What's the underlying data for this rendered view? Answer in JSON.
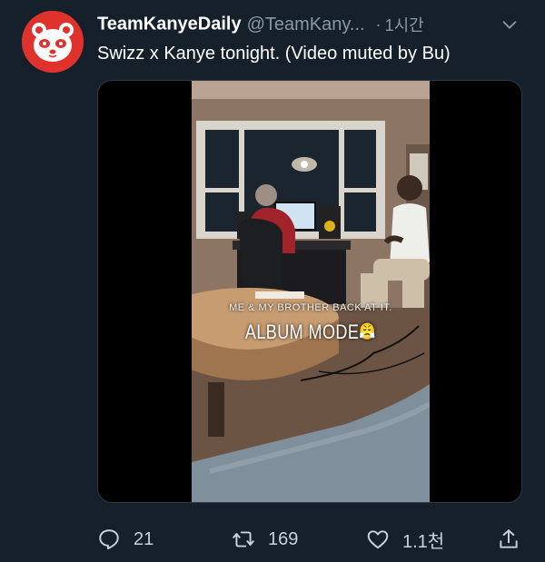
{
  "tweet": {
    "display_name": "TeamKanyeDaily",
    "handle": "@TeamKany...",
    "separator": "·",
    "time": "1시간",
    "text": "Swizz x Kanye tonight. (Video muted by Bu)"
  },
  "video": {
    "caption_line1": "ME & MY BROTHER BACK AT IT.",
    "caption_line2": "ALBUM MODE",
    "caption_emoji": "😤"
  },
  "actions": {
    "replies": "21",
    "retweets": "169",
    "likes": "1.1천"
  },
  "colors": {
    "background": "#15202b",
    "secondary_text": "#8899a6",
    "avatar_red": "#e0322c"
  },
  "icons": {
    "avatar": "panda-avatar",
    "menu": "chevron-down-icon",
    "reply": "reply-icon",
    "retweet": "retweet-icon",
    "like": "heart-icon",
    "share": "share-icon"
  }
}
